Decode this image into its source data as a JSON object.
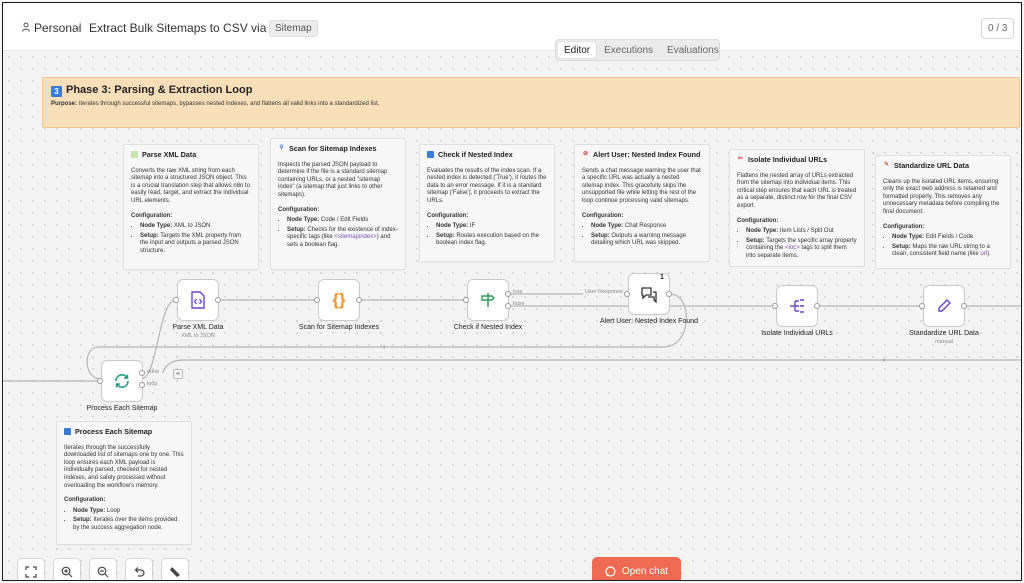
{
  "header": {
    "breadcrumb_personal": "Personal",
    "breadcrumb_sep": "/",
    "workflow_title": "Extract Bulk Sitemaps to CSV via Chat",
    "tag": "Sitemap",
    "counter": "0 / 3"
  },
  "tabs": [
    {
      "label": "Editor",
      "active": true
    },
    {
      "label": "Executions",
      "active": false
    },
    {
      "label": "Evaluations",
      "active": false
    }
  ],
  "phase": {
    "badge": "3",
    "title": "Phase 3: Parsing & Extraction Loop",
    "purpose_label": "Purpose:",
    "purpose_text": "Iterates through successful sitemaps, bypasses nested indexes, and flattens all valid links into a standardized list."
  },
  "notes": {
    "parse_xml": {
      "title": "Parse XML Data",
      "body": "Converts the raw XML string from each sitemap into a structured JSON object. This is a crucial translation step that allows n8n to easily read, target, and extract the individual URL elements.",
      "config_label": "Configuration:",
      "node_type_label": "Node Type:",
      "node_type": "XML to JSON",
      "setup_label": "Setup:",
      "setup": "Targets the XML property from the input and outputs a parsed JSON structure."
    },
    "scan_sitemap": {
      "title": "Scan for Sitemap Indexes",
      "body": "Inspects the parsed JSON payload to determine if the file is a standard sitemap containing URLs, or a nested \"sitemap index\" (a sitemap that just links to other sitemaps).",
      "config_label": "Configuration:",
      "node_type_label": "Node Type:",
      "node_type": "Code / Edit Fields",
      "setup_label": "Setup:",
      "setup_a": "Checks for the existence of index-specific tags (like",
      "setup_code": "<sitemapindex>",
      "setup_b": ") and sets a boolean flag."
    },
    "check_nested": {
      "title": "Check if Nested Index",
      "body": "Evaluates the results of the index scan. If a nested index is detected ('True'), it routes the data to an error message. If it is a standard sitemap ('False'), it proceeds to extract the URLs.",
      "config_label": "Configuration:",
      "node_type_label": "Node Type:",
      "node_type": "IF",
      "setup_label": "Setup:",
      "setup": "Routes execution based on the boolean index flag."
    },
    "alert_user": {
      "title": "Alert User: Nested Index Found",
      "body": "Sends a chat message warning the user that a specific URL was actually a nested sitemap index. This gracefully skips the unsupported file while letting the rest of the loop continue processing valid sitemaps.",
      "config_label": "Configuration:",
      "node_type_label": "Node Type:",
      "node_type": "Chat Response",
      "setup_label": "Setup:",
      "setup": "Outputs a warning message detailing which URL was skipped."
    },
    "isolate_urls": {
      "title": "Isolate Individual URLs",
      "body": "Flattens the nested array of URLs extracted from the sitemap into individual items. This critical step ensures that each URL is treated as a separate, distinct row for the final CSV export.",
      "config_label": "Configuration:",
      "node_type_label": "Node Type:",
      "node_type": "Item Lists / Split Out",
      "setup_label": "Setup:",
      "setup_a": "Targets the specific array property containing the",
      "setup_code": "<loc>",
      "setup_b": "tags to split them into separate items."
    },
    "standardize": {
      "title": "Standardize URL Data",
      "body": "Cleans up the isolated URL items, ensuring only the exact web address is retained and formatted properly. This removes any unnecessary metadata before compiling the final document.",
      "config_label": "Configuration:",
      "node_type_label": "Node Type:",
      "node_type": "Edit Fields / Code",
      "setup_label": "Setup:",
      "setup_a": "Maps the raw URL string to a clean, consistent field name (like",
      "setup_code": "url",
      "setup_b": ")."
    },
    "process_each": {
      "title": "Process Each Sitemap",
      "body": "Iterates through the successfully downloaded list of sitemaps one by one. This loop ensures each XML payload is individually parsed, checked for nested indexes, and safely processed without overloading the workflow's memory.",
      "config_label": "Configuration:",
      "node_type_label": "Node Type:",
      "node_type": "Loop",
      "setup_label": "Setup:",
      "setup": "Iterates over the items provided by the success aggregation node."
    }
  },
  "nodes": {
    "parse_xml": {
      "label": "Parse XML Data",
      "sub": "XML to JSON"
    },
    "scan_sitemap": {
      "label": "Scan for Sitemap Indexes"
    },
    "check_nested": {
      "label": "Check if Nested Index",
      "true_label": "true",
      "false_label": "false"
    },
    "alert_user": {
      "label": "Alert User: Nested Index Found",
      "badge": "1",
      "edge_label": "User Response"
    },
    "isolate_urls": {
      "label": "Isolate Individual URLs"
    },
    "standardize": {
      "label": "Standardize URL Data",
      "sub": "manual"
    },
    "process_each": {
      "label": "Process Each Sitemap",
      "done_label": "done",
      "loop_label": "loop"
    }
  },
  "toolbar": {
    "open_chat": "Open chat"
  },
  "colors": {
    "accent": "#ef6a53",
    "sticky_orange": "#f9deba",
    "node_purple": "#6b46c1",
    "node_orange": "#f0932b",
    "node_green": "#2f9e5b",
    "node_teal": "#1f9d86"
  }
}
